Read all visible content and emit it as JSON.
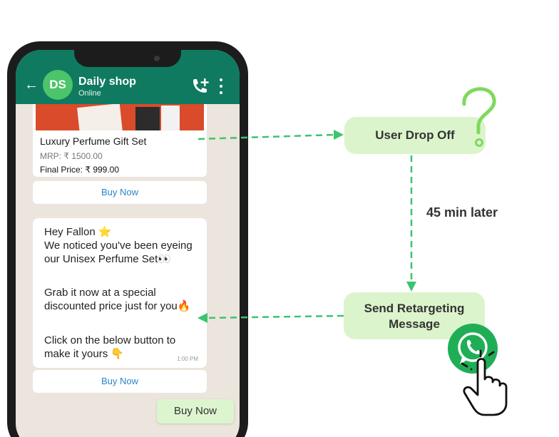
{
  "chat": {
    "back_icon": "arrow-left-icon",
    "avatar_initials": "DS",
    "name": "Daily shop",
    "status": "Online",
    "call_icon": "add-call-icon",
    "menu_icon": "more-vertical-icon"
  },
  "product": {
    "title": "Luxury Perfume Gift Set",
    "mrp": "MRP: ₹ 1500.00",
    "final_price": "Final Price: ₹ 999.00",
    "button": "Buy Now"
  },
  "message": {
    "line1": "Hey Fallon ⭐",
    "line2": "We noticed you've been eyeing our Unisex Perfume Set👀",
    "line3": "Grab it now at a special discounted price just for you🔥",
    "line4": "Click on the below button to make it yours 👇",
    "time": "1:00 PM",
    "button": "Buy Now"
  },
  "quick_reply": "Buy Now",
  "flow": {
    "drop_off": "User Drop Off",
    "delay": "45 min later",
    "send_line1": "Send Retargeting",
    "send_line2": "Message",
    "question_icon": "question-mark-icon",
    "whatsapp_icon": "whatsapp-icon",
    "hand_icon": "hand-pointer-icon"
  },
  "colors": {
    "header": "#0f7a5f",
    "accent_green": "#4bc46a",
    "arrow": "#3cc46e",
    "box": "#dcf4cc",
    "chat_bg": "#ece5dd"
  }
}
